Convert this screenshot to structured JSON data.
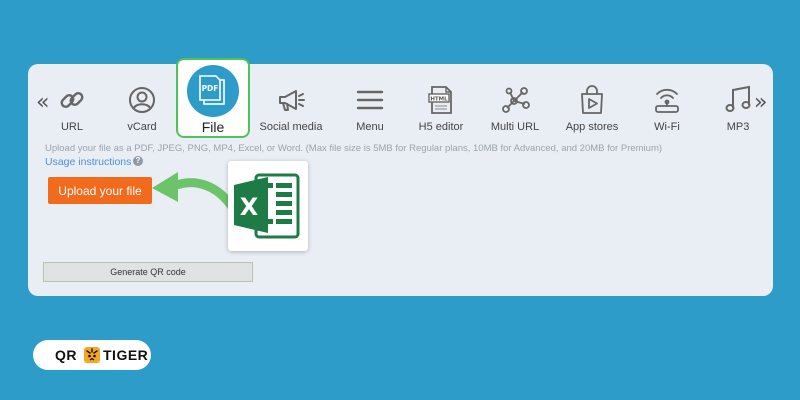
{
  "nav": {
    "prev_label": "«",
    "next_label": "»"
  },
  "tabs": [
    {
      "label": "URL",
      "icon": "link-icon"
    },
    {
      "label": "vCard",
      "icon": "user-circle-icon"
    },
    {
      "label": "File",
      "icon": "pdf-file-icon",
      "active": true
    },
    {
      "label": "Social media",
      "icon": "megaphone-icon"
    },
    {
      "label": "Menu",
      "icon": "hamburger-menu-icon"
    },
    {
      "label": "H5 editor",
      "icon": "html-file-icon"
    },
    {
      "label": "Multi URL",
      "icon": "network-nodes-icon"
    },
    {
      "label": "App stores",
      "icon": "shopping-bag-play-icon"
    },
    {
      "label": "Wi-Fi",
      "icon": "wifi-router-icon"
    },
    {
      "label": "MP3",
      "icon": "music-note-icon"
    }
  ],
  "file_icon_text": "PDF",
  "html_icon_text": "HTML",
  "upload": {
    "instructions": "Upload your file as a PDF, JPEG, PNG, MP4, Excel, or Word. (Max file size is 5MB for Regular plans, 10MB for Advanced, and 20MB for Premium)",
    "usage_link": "Usage instructions",
    "help_glyph": "?",
    "button_label": "Upload your file"
  },
  "excel_letter": "X",
  "generate_label": "Generate QR code",
  "brand": {
    "left": "QR",
    "right": "TIGER"
  },
  "colors": {
    "background": "#2e9cc8",
    "panel": "#e9eef4",
    "accent_green": "#4fc25a",
    "upload_orange": "#f26a1b",
    "excel_green": "#1e7b45",
    "arrow_green": "#6dc36a",
    "link_blue": "#4a8fd6"
  }
}
